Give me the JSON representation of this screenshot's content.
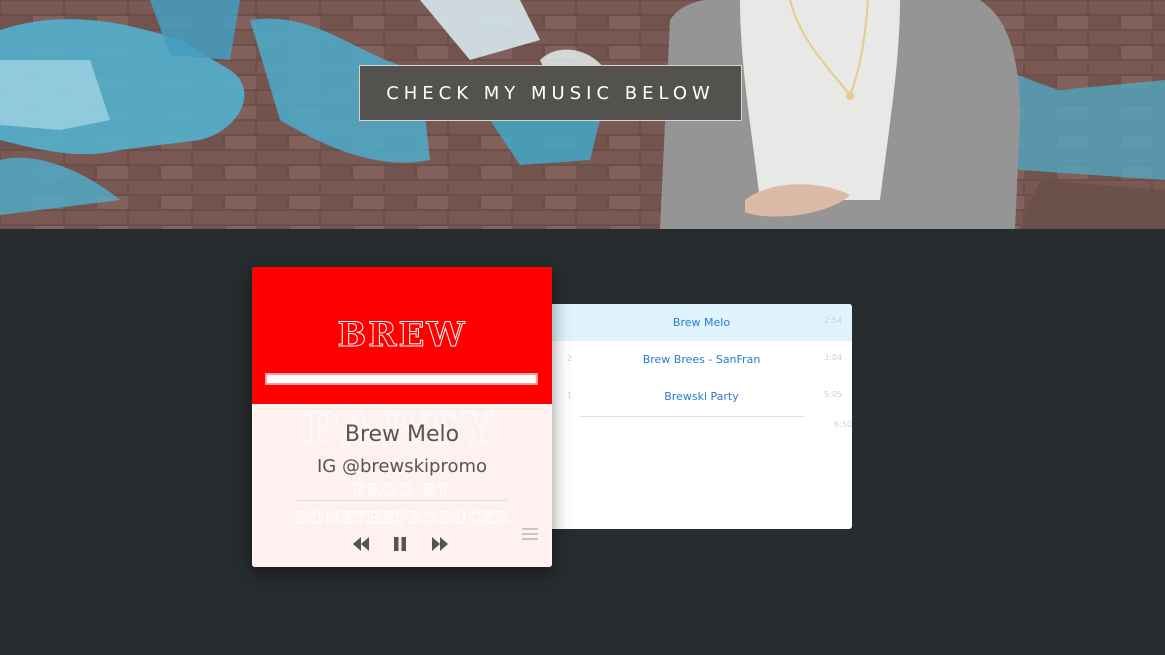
{
  "hero": {
    "cta_label": "CHECK MY MUSIC BELOW"
  },
  "player": {
    "artwork": {
      "title": "BREW",
      "line2": "PARTY",
      "line3": "PROD BY",
      "line4": "BONETHEPRODUCER"
    },
    "now_playing": {
      "track": "Brew Melo",
      "artist": "IG @brewskipromo"
    },
    "controls": {
      "prev_icon": "rewind-icon",
      "play_pause_icon": "pause-icon",
      "next_icon": "fast-forward-icon",
      "menu_icon": "hamburger-menu-icon"
    }
  },
  "playlist": {
    "tracks": [
      {
        "num": "",
        "title": "Brew Melo",
        "duration": "2:54"
      },
      {
        "num": "2",
        "title": "Brew Brees - SanFran",
        "duration": "3:04"
      },
      {
        "num": "1",
        "title": "Brewski Party",
        "duration": "5:05"
      }
    ],
    "extra_duration": "6:50"
  },
  "colors": {
    "page_bg": "#272c2f",
    "cta_bg": "#54524f",
    "art_red": "#ff0000",
    "active_row": "#dff4fc",
    "link_blue": "#2a7ad0"
  }
}
